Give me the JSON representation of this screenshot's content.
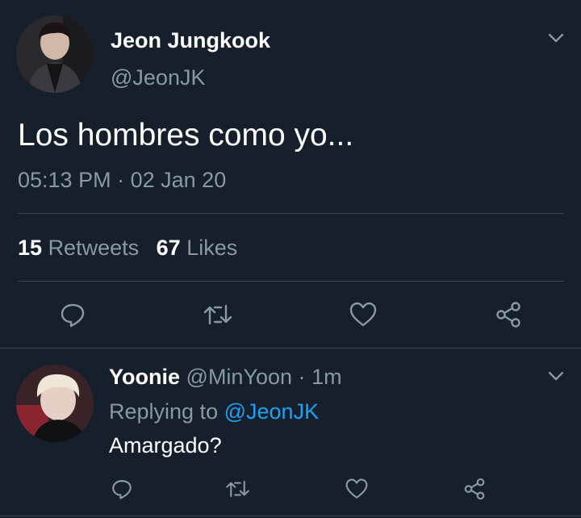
{
  "main_tweet": {
    "display_name": "Jeon Jungkook",
    "handle": "@JeonJK",
    "text": "Los hombres como yo...",
    "time": "05:13 PM",
    "separator": "·",
    "date": "02 Jan 20",
    "retweets_count": "15",
    "retweets_label": "Retweets",
    "likes_count": "67",
    "likes_label": "Likes"
  },
  "reply": {
    "display_name": "Yoonie",
    "handle": "@MinYoon",
    "separator": "·",
    "age": "1m",
    "replying_prefix": "Replying to",
    "replying_handle": "@JeonJK",
    "text": "Amargado?"
  },
  "colors": {
    "background": "#16202c",
    "muted": "#8899a6",
    "link": "#1da1f2",
    "divider": "#38444d"
  },
  "icons": [
    "chevron-down-icon",
    "reply-icon",
    "retweet-icon",
    "like-icon",
    "share-icon"
  ]
}
